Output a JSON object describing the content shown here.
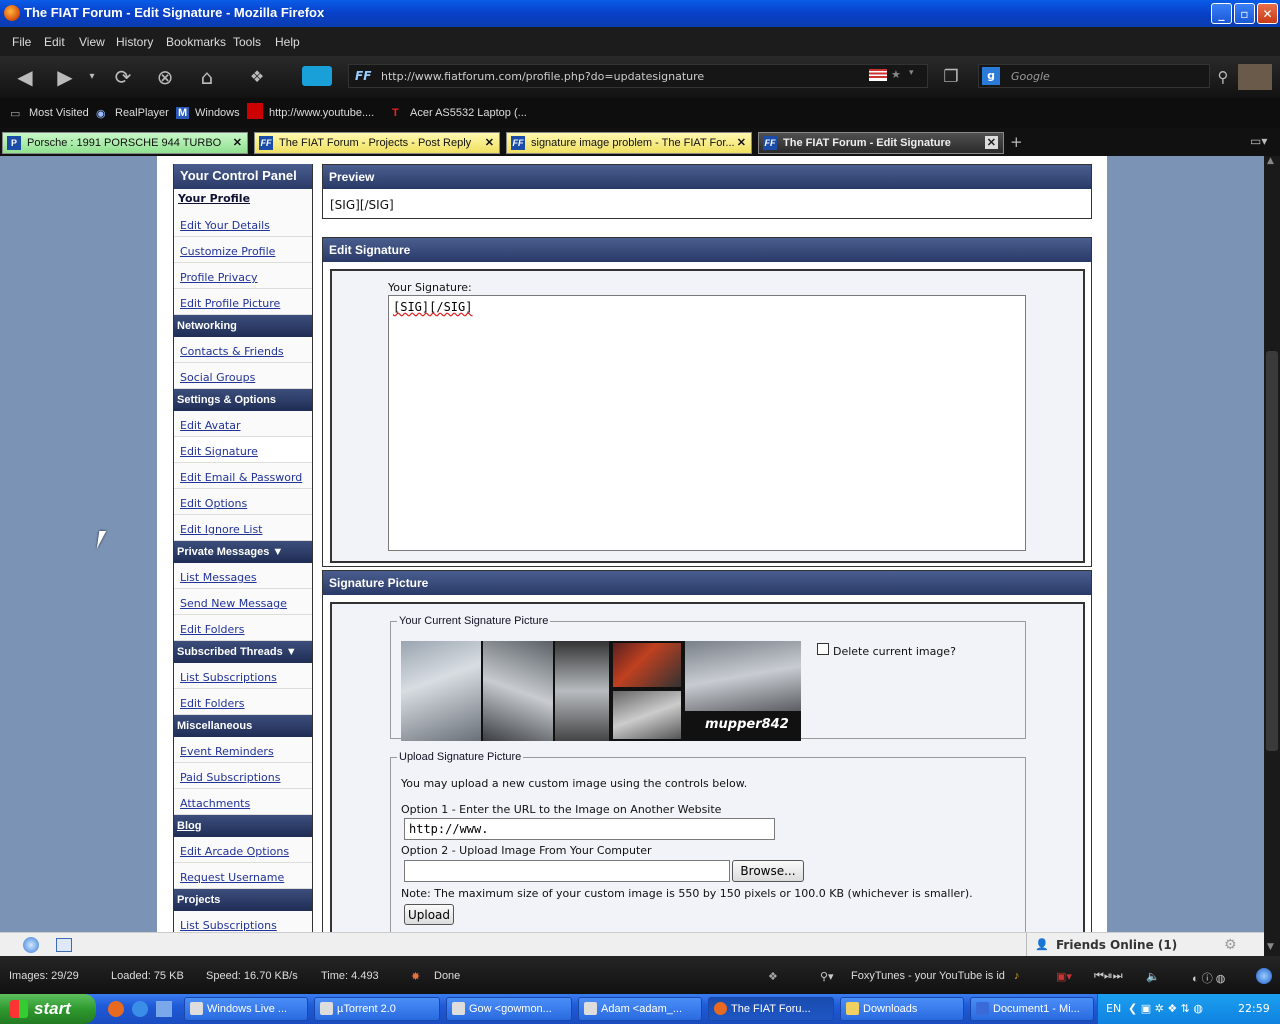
{
  "window": {
    "title": "The FIAT Forum - Edit Signature - Mozilla Firefox"
  },
  "menu": [
    "File",
    "Edit",
    "View",
    "History",
    "Bookmarks",
    "Tools",
    "Help"
  ],
  "nav": {
    "url": "http://www.fiatforum.com/profile.php?do=updatesignature",
    "search_placeholder": "Google"
  },
  "bookmarks": [
    "Most Visited",
    "RealPlayer",
    "Windows",
    "http://www.youtube....",
    "Acer AS5532 Laptop (..."
  ],
  "tabs": [
    {
      "label": "Porsche : 1991 PORSCHE 944 TURBO"
    },
    {
      "label": "The FIAT Forum - Projects - Post Reply"
    },
    {
      "label": "signature image problem - The FIAT For..."
    },
    {
      "label": "The FIAT Forum - Edit Signature"
    }
  ],
  "sidebar": {
    "title": "Your Control Panel",
    "profile_label": "Your Profile",
    "profile_items": [
      "Edit Your Details",
      "Customize Profile",
      "Profile Privacy",
      "Edit Profile Picture"
    ],
    "networking_label": "Networking",
    "networking_items": [
      "Contacts & Friends",
      "Social Groups"
    ],
    "settings_label": "Settings & Options",
    "settings_items": [
      "Edit Avatar",
      "Edit Signature",
      "Edit Email & Password",
      "Edit Options",
      "Edit Ignore List"
    ],
    "pm_label": "Private Messages",
    "pm_items": [
      "List Messages",
      "Send New Message",
      "Edit Folders"
    ],
    "subs_label": "Subscribed Threads",
    "subs_items": [
      "List Subscriptions",
      "Edit Folders"
    ],
    "misc_label": "Miscellaneous",
    "misc_items": [
      "Event Reminders",
      "Paid Subscriptions",
      "Attachments"
    ],
    "blog_label": "Blog",
    "blog_items": [
      "Edit Arcade Options",
      "Request Username"
    ],
    "projects_label": "Projects",
    "projects_items": [
      "List Subscriptions"
    ]
  },
  "preview": {
    "title": "Preview",
    "content": "[SIG][/SIG]"
  },
  "edit_signature": {
    "title": "Edit Signature",
    "label": "Your Signature:",
    "value": "[SIG][/SIG]"
  },
  "sig_picture": {
    "title": "Signature Picture",
    "current_legend": "Your Current Signature Picture",
    "delete_label": "Delete current image?",
    "image_caption": "mupper842",
    "upload_legend": "Upload Signature Picture",
    "upload_intro": "You may upload a new custom image using the controls below.",
    "option1": "Option 1 - Enter the URL to the Image on Another Website",
    "url_value": "http://www.",
    "option2": "Option 2 - Upload Image From Your Computer",
    "browse_label": "Browse...",
    "note": "Note: The maximum size of your custom image is 550 by 150 pixels or 100.0 KB (whichever is smaller).",
    "upload_button": "Upload"
  },
  "addonbar": {
    "friends": "Friends Online (1)"
  },
  "status": {
    "images": "Images: 29/29",
    "loaded": "Loaded: 75 KB",
    "speed": "Speed: 16.70 KB/s",
    "time": "Time: 4.493",
    "done": "Done",
    "foxytunes": "FoxyTunes - your YouTube is id"
  },
  "taskbar": {
    "start": "start",
    "tasks": [
      "Windows Live ...",
      "µTorrent 2.0",
      "Gow <gowmon...",
      "Adam <adam_...",
      "The FIAT Foru...",
      "Downloads",
      "Document1 - Mi..."
    ],
    "lang": "EN",
    "clock": "22:59"
  }
}
